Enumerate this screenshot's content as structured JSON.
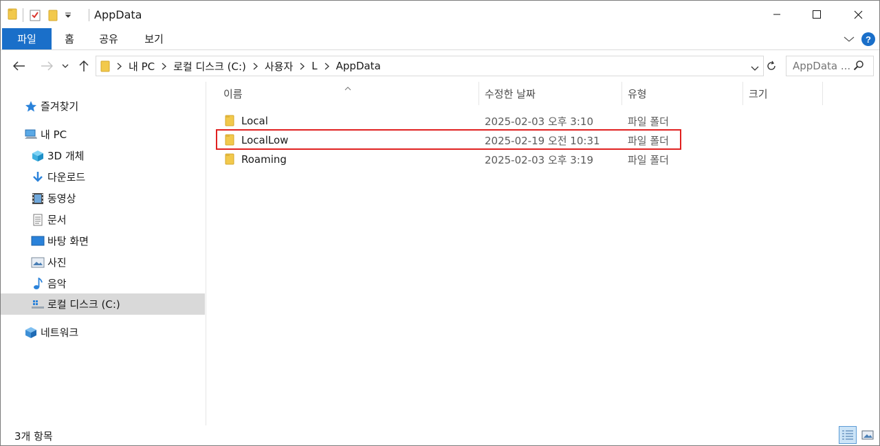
{
  "window": {
    "title": "AppData"
  },
  "ribbon": {
    "tabs": [
      "파일",
      "홈",
      "공유",
      "보기"
    ]
  },
  "address": {
    "crumbs": [
      "내 PC",
      "로컬 디스크 (C:)",
      "사용자",
      "L",
      "AppData"
    ],
    "search_placeholder": "AppData ..."
  },
  "sidebar": {
    "items": [
      {
        "label": "즐겨찾기",
        "icon": "star-icon"
      },
      {
        "label": "내 PC",
        "icon": "pc-icon"
      },
      {
        "label": "3D 개체",
        "icon": "3d-objects-icon"
      },
      {
        "label": "다운로드",
        "icon": "download-icon"
      },
      {
        "label": "동영상",
        "icon": "videos-icon"
      },
      {
        "label": "문서",
        "icon": "documents-icon"
      },
      {
        "label": "바탕 화면",
        "icon": "desktop-icon"
      },
      {
        "label": "사진",
        "icon": "pictures-icon"
      },
      {
        "label": "음악",
        "icon": "music-icon"
      },
      {
        "label": "로컬 디스크 (C:)",
        "icon": "drive-icon",
        "selected": true
      },
      {
        "label": "네트워크",
        "icon": "network-icon"
      }
    ]
  },
  "columns": {
    "name": "이름",
    "date": "수정한 날짜",
    "type": "유형",
    "size": "크기"
  },
  "files": [
    {
      "name": "Local",
      "date": "2025-02-03 오후 3:10",
      "type": "파일 폴더"
    },
    {
      "name": "LocalLow",
      "date": "2025-02-19 오전 10:31",
      "type": "파일 폴더",
      "highlighted": true
    },
    {
      "name": "Roaming",
      "date": "2025-02-03 오후 3:19",
      "type": "파일 폴더"
    }
  ],
  "status": {
    "item_count": "3개 항목"
  },
  "colors": {
    "accent": "#1a6fc9",
    "highlight_border": "#e0201f",
    "selected_nav": "#d9d9d9",
    "folder": "#f2c94c"
  }
}
